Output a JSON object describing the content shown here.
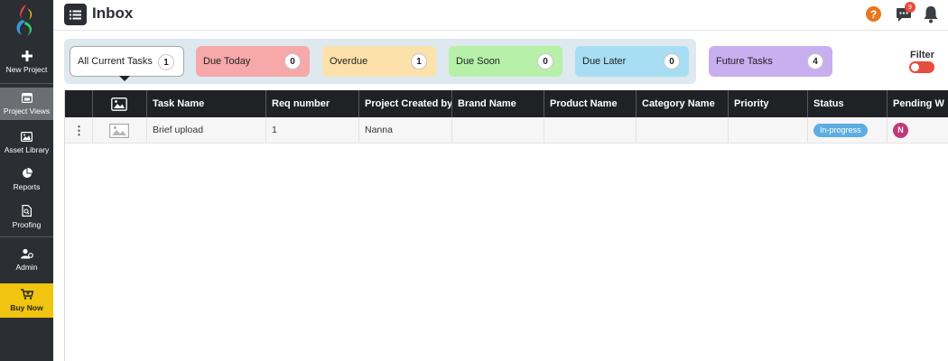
{
  "sidebar": {
    "items": [
      {
        "label": "New Project",
        "icon": "plus-icon"
      },
      {
        "label": "Project Views",
        "icon": "project-views-icon"
      },
      {
        "label": "Asset Library",
        "icon": "image-icon"
      },
      {
        "label": "Reports",
        "icon": "pie-chart-icon"
      },
      {
        "label": "Proofing",
        "icon": "proofing-icon"
      },
      {
        "label": "Admin",
        "icon": "admin-users-icon"
      },
      {
        "label": "Buy Now",
        "icon": "cart-icon"
      }
    ],
    "active_color": "#6b6e73",
    "buy_color": "#f1c40f"
  },
  "header": {
    "title": "Inbox",
    "help_glyph": "?",
    "chat_badge_count": "9"
  },
  "task_cards": [
    {
      "label": "All Current Tasks",
      "count": "1",
      "color": "#ffffff"
    },
    {
      "label": "Due Today",
      "count": "0",
      "color": "#f7a8a8"
    },
    {
      "label": "Overdue",
      "count": "1",
      "color": "#fde1aa"
    },
    {
      "label": "Due Soon",
      "count": "0",
      "color": "#b6f0a9"
    },
    {
      "label": "Due Later",
      "count": "0",
      "color": "#a8def3"
    },
    {
      "label": "Future Tasks",
      "count": "4",
      "color": "#c9aef0"
    }
  ],
  "filter": {
    "label": "Filter",
    "color": "#e74c3c"
  },
  "table": {
    "columns": [
      "Task Name",
      "Req number",
      "Project Created by",
      "Brand Name",
      "Product Name",
      "Category Name",
      "Priority",
      "Status",
      "Pending W"
    ],
    "rows": [
      {
        "task_name": "Brief upload",
        "req_number": "1",
        "created_by": "Nanna",
        "brand_name": "",
        "product_name": "",
        "category_name": "",
        "priority": "",
        "status": "In-progress",
        "pending_initial": "N"
      }
    ]
  }
}
